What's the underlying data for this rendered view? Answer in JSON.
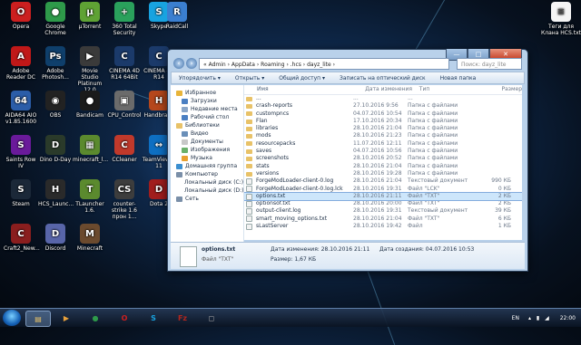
{
  "desktop": {
    "icons": [
      {
        "label": "Opera",
        "color": "#cc1f1f",
        "glyph": "O",
        "col": 0,
        "row": 0
      },
      {
        "label": "Google Chrome",
        "color": "#2e9a4a",
        "glyph": "●",
        "col": 1,
        "row": 0
      },
      {
        "label": "µTorrent",
        "color": "#5fa234",
        "glyph": "µ",
        "col": 2,
        "row": 0
      },
      {
        "label": "360 Total Security",
        "color": "#2aa15c",
        "glyph": "+",
        "col": 3,
        "row": 0
      },
      {
        "label": "Skype",
        "color": "#18a3e0",
        "glyph": "S",
        "col": 4,
        "row": 0
      },
      {
        "label": "Adobe Reader DC",
        "color": "#c01818",
        "glyph": "A",
        "col": 0,
        "row": 1
      },
      {
        "label": "Adobe Photosh...",
        "color": "#0f3f6b",
        "glyph": "Ps",
        "col": 1,
        "row": 1
      },
      {
        "label": "Movie Studio Platinum 12.0",
        "color": "#3a3a3a",
        "glyph": "▶",
        "col": 2,
        "row": 1
      },
      {
        "label": "CINEMA 4D R14 64Bit",
        "color": "#1b3a6a",
        "glyph": "C",
        "col": 3,
        "row": 1
      },
      {
        "label": "CINEMA 4D R14",
        "color": "#1b3a6a",
        "glyph": "C",
        "col": 4,
        "row": 1
      },
      {
        "label": "AIDA64 AIO v1.85.1600",
        "color": "#2b5da8",
        "glyph": "64",
        "col": 0,
        "row": 2
      },
      {
        "label": "OBS",
        "color": "#222",
        "glyph": "◉",
        "col": 1,
        "row": 2
      },
      {
        "label": "Bandicam",
        "color": "#1b1b1b",
        "glyph": "●",
        "col": 2,
        "row": 2
      },
      {
        "label": "CPU_Control",
        "color": "#6b6b6b",
        "glyph": "▣",
        "col": 3,
        "row": 2
      },
      {
        "label": "Handbrake",
        "color": "#b5471c",
        "glyph": "H",
        "col": 4,
        "row": 2
      },
      {
        "label": "Saints Row IV",
        "color": "#6a1a9a",
        "glyph": "S",
        "col": 0,
        "row": 3
      },
      {
        "label": "Dino D-Day",
        "color": "#2a3a2a",
        "glyph": "D",
        "col": 1,
        "row": 3
      },
      {
        "label": "minecraft_l...",
        "color": "#5b8a2e",
        "glyph": "▦",
        "col": 2,
        "row": 3
      },
      {
        "label": "CCleaner",
        "color": "#c0392b",
        "glyph": "C",
        "col": 3,
        "row": 3
      },
      {
        "label": "TeamViewer 11",
        "color": "#0e6fc2",
        "glyph": "↔",
        "col": 4,
        "row": 3
      },
      {
        "label": "Steam",
        "color": "#1b2838",
        "glyph": "S",
        "col": 0,
        "row": 4
      },
      {
        "label": "HCS_Launc...",
        "color": "#2a2a2a",
        "glyph": "H",
        "col": 1,
        "row": 4
      },
      {
        "label": "TLauncher 1.6.",
        "color": "#5b8a2e",
        "glyph": "T",
        "col": 2,
        "row": 4
      },
      {
        "label": "counter-strike 1.6 прон 1...",
        "color": "#3d3d3d",
        "glyph": "CS",
        "col": 3,
        "row": 4
      },
      {
        "label": "Dota 2",
        "color": "#a11d1d",
        "glyph": "D",
        "col": 4,
        "row": 4
      },
      {
        "label": "Craft2_New...",
        "color": "#8a1e1e",
        "glyph": "C",
        "col": 0,
        "row": 5
      },
      {
        "label": "Discord",
        "color": "#5865a8",
        "glyph": "D",
        "col": 1,
        "row": 5
      },
      {
        "label": "Minecraft",
        "color": "#6b4a2e",
        "glyph": "M",
        "col": 2,
        "row": 5
      }
    ],
    "extra": [
      {
        "label": "RaidCall",
        "color": "#3b7fd0",
        "glyph": "R"
      },
      {
        "label": "Теги для Клана HCS.txt",
        "color": "#f5f5f5",
        "glyph": "≡"
      }
    ]
  },
  "window": {
    "controls": {
      "minimize": "—",
      "maximize": "□",
      "close": "✕"
    },
    "address": "« Admin › AppData › Roaming › .hcs › dayz_lite ›",
    "search_placeholder": "Поиск: dayz_lite",
    "toolbar": [
      "Упорядочить ▾",
      "Открыть ▾",
      "Общий доступ ▾",
      "Записать на оптический диск",
      "Новая папка"
    ],
    "nav": [
      {
        "label": "Избранное",
        "color": "#e8b43a",
        "bold": true
      },
      {
        "label": "Загрузки",
        "color": "#4a7fc2"
      },
      {
        "label": "Недавние места",
        "color": "#8aa6c8"
      },
      {
        "label": "Рабочий стол",
        "color": "#4a7fc2"
      },
      {
        "label": "",
        "color": "transparent"
      },
      {
        "label": "Библиотеки",
        "color": "#e8c268",
        "bold": true
      },
      {
        "label": "Видео",
        "color": "#6a8fb8"
      },
      {
        "label": "Документы",
        "color": "#c8c8c8"
      },
      {
        "label": "Изображения",
        "color": "#6ab06a"
      },
      {
        "label": "Музыка",
        "color": "#e8a030"
      },
      {
        "label": "",
        "color": "transparent"
      },
      {
        "label": "Домашняя группа",
        "color": "#3b8fd0",
        "bold": true
      },
      {
        "label": "",
        "color": "transparent"
      },
      {
        "label": "Компьютер",
        "color": "#7a8fa8",
        "bold": true
      },
      {
        "label": "Локальный диск (C:)",
        "color": "#9aa8b8"
      },
      {
        "label": "Локальный диск (D:)",
        "color": "#9aa8b8"
      },
      {
        "label": "",
        "color": "transparent"
      },
      {
        "label": "Сеть",
        "color": "#7a8fa8",
        "bold": true
      }
    ],
    "columns": [
      "Имя",
      "Дата изменения",
      "Тип",
      "Размер"
    ],
    "files": [
      {
        "name": "...",
        "date": "...",
        "type": "...",
        "size": "",
        "kind": "folder"
      },
      {
        "name": "crash-reports",
        "date": "27.10.2016 9:56",
        "type": "Папка с файлами",
        "size": "",
        "kind": "folder"
      },
      {
        "name": "custompncs",
        "date": "04.07.2016 10:54",
        "type": "Папка с файлами",
        "size": "",
        "kind": "folder"
      },
      {
        "name": "Flan",
        "date": "17.10.2016 20:34",
        "type": "Папка с файлами",
        "size": "",
        "kind": "folder"
      },
      {
        "name": "libraries",
        "date": "28.10.2016 21:04",
        "type": "Папка с файлами",
        "size": "",
        "kind": "folder"
      },
      {
        "name": "mods",
        "date": "28.10.2016 21:23",
        "type": "Папка с файлами",
        "size": "",
        "kind": "folder"
      },
      {
        "name": "resourcepacks",
        "date": "11.07.2016 12:11",
        "type": "Папка с файлами",
        "size": "",
        "kind": "folder"
      },
      {
        "name": "saves",
        "date": "04.07.2016 10:56",
        "type": "Папка с файлами",
        "size": "",
        "kind": "folder"
      },
      {
        "name": "screenshots",
        "date": "28.10.2016 20:52",
        "type": "Папка с файлами",
        "size": "",
        "kind": "folder"
      },
      {
        "name": "stats",
        "date": "28.10.2016 21:04",
        "type": "Папка с файлами",
        "size": "",
        "kind": "folder"
      },
      {
        "name": "versions",
        "date": "28.10.2016 19:28",
        "type": "Папка с файлами",
        "size": "",
        "kind": "folder"
      },
      {
        "name": "ForgeModLoader-client-0.log",
        "date": "28.10.2016 21:04",
        "type": "Текстовый документ",
        "size": "990 КБ",
        "kind": "doc"
      },
      {
        "name": "ForgeModLoader-client-0.log.lck",
        "date": "28.10.2016 19:31",
        "type": "Файл \"LCK\"",
        "size": "0 КБ",
        "kind": "doc"
      },
      {
        "name": "options.txt",
        "date": "28.10.2016 21:11",
        "type": "Файл \"TXT\"",
        "size": "2 КБ",
        "kind": "doc",
        "selected": true
      },
      {
        "name": "optionsof.txt",
        "date": "28.10.2016 20:00",
        "type": "Файл \"TXT\"",
        "size": "2 КБ",
        "kind": "doc"
      },
      {
        "name": "output-client.log",
        "date": "28.10.2016 19:31",
        "type": "Текстовый документ",
        "size": "39 КБ",
        "kind": "doc"
      },
      {
        "name": "smart_moving_options.txt",
        "date": "28.10.2016 21:04",
        "type": "Файл \"TXT\"",
        "size": "6 КБ",
        "kind": "doc"
      },
      {
        "name": "sLastServer",
        "date": "28.10.2016 19:42",
        "type": "Файл",
        "size": "1 КБ",
        "kind": "doc"
      }
    ],
    "details": {
      "name": "options.txt",
      "modified_label": "Дата изменения: 28.10.2016 21:11",
      "created_label": "Дата создания: 04.07.2016 10:53",
      "type_label": "Файл \"TXT\"",
      "size_label": "Размер: 1,67 КБ"
    }
  },
  "taskbar": {
    "apps": [
      {
        "name": "explorer",
        "color": "#e8c268",
        "glyph": "▤",
        "active": true
      },
      {
        "name": "media",
        "color": "#e9a13b",
        "glyph": "▶",
        "active": false
      },
      {
        "name": "chrome",
        "color": "#2e9a4a",
        "glyph": "●",
        "active": false
      },
      {
        "name": "opera",
        "color": "#cc1f1f",
        "glyph": "O",
        "active": false
      },
      {
        "name": "skype",
        "color": "#18a3e0",
        "glyph": "S",
        "active": false
      },
      {
        "name": "filezilla",
        "color": "#b3261e",
        "glyph": "Fz",
        "active": false
      },
      {
        "name": "extra-app",
        "color": "#a8a8a8",
        "glyph": "◻",
        "active": false
      }
    ],
    "language": "EN",
    "time": "22:00"
  }
}
